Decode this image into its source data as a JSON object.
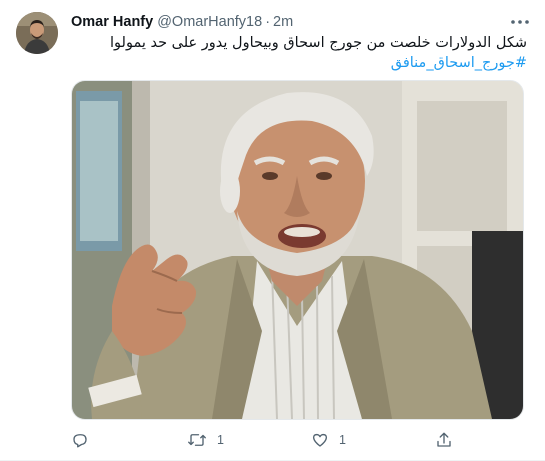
{
  "tweet": {
    "author": {
      "display_name": "Omar Hanfy",
      "handle": "@OmarHanfy18",
      "separator": "·",
      "time": "2m"
    },
    "text_line1": "شكل الدولارات خلصت من جورج اسحاق وبيحاول يدور على حد يمولوا",
    "hashtag": "#جورج_اسحاق_منافق",
    "media": {
      "alt": "Photo of an older man with white hair in a beige jacket gesturing with his hand"
    },
    "actions": {
      "reply_count": "",
      "retweet_count": "1",
      "like_count": "1"
    }
  },
  "icons": [
    "avatar-photo",
    "more-icon",
    "reply-icon",
    "retweet-icon",
    "like-icon",
    "share-icon"
  ],
  "colors": {
    "link": "#1d9bf0",
    "secondary_text": "#536471",
    "primary_text": "#0f1419"
  }
}
